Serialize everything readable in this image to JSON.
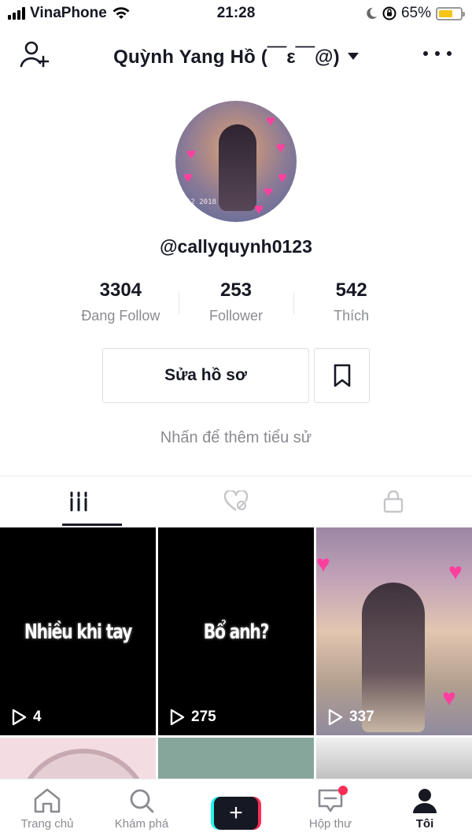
{
  "status_bar": {
    "carrier": "VinaPhone",
    "time": "21:28",
    "battery_text": "65%",
    "battery_level": 0.65,
    "battery_color": "#f5c518"
  },
  "header": {
    "title": "Quỳnh Yang Hồ (￣ε￣@)",
    "add_user_icon": "add-user-icon",
    "more_icon": "more-icon"
  },
  "profile": {
    "avatar_date_text": "12 2018",
    "username": "@callyquynh0123",
    "stats": [
      {
        "value": "3304",
        "label": "Đang Follow"
      },
      {
        "value": "253",
        "label": "Follower"
      },
      {
        "value": "542",
        "label": "Thích"
      }
    ],
    "edit_button": "Sửa hồ sơ",
    "bio_placeholder": "Nhấn để thêm tiểu sử"
  },
  "tabs": [
    {
      "icon": "grid-icon",
      "active": true
    },
    {
      "icon": "liked-hidden-icon",
      "active": false
    },
    {
      "icon": "lock-icon",
      "active": false
    }
  ],
  "videos": [
    {
      "caption": "Nhiều khi tay",
      "views": "4"
    },
    {
      "caption": "Bổ anh?",
      "views": "275"
    },
    {
      "caption": "",
      "views": "337"
    }
  ],
  "bottom_nav": [
    {
      "label": "Trang chủ",
      "icon": "home-icon"
    },
    {
      "label": "Khám phá",
      "icon": "search-icon"
    },
    {
      "label": "",
      "icon": "plus-icon"
    },
    {
      "label": "Hộp thư",
      "icon": "inbox-icon"
    },
    {
      "label": "Tôi",
      "icon": "profile-icon"
    }
  ],
  "colors": {
    "accent_red": "#fe2c55",
    "accent_cyan": "#25f4ee",
    "text_primary": "#161823",
    "text_secondary": "#8a8b91"
  }
}
